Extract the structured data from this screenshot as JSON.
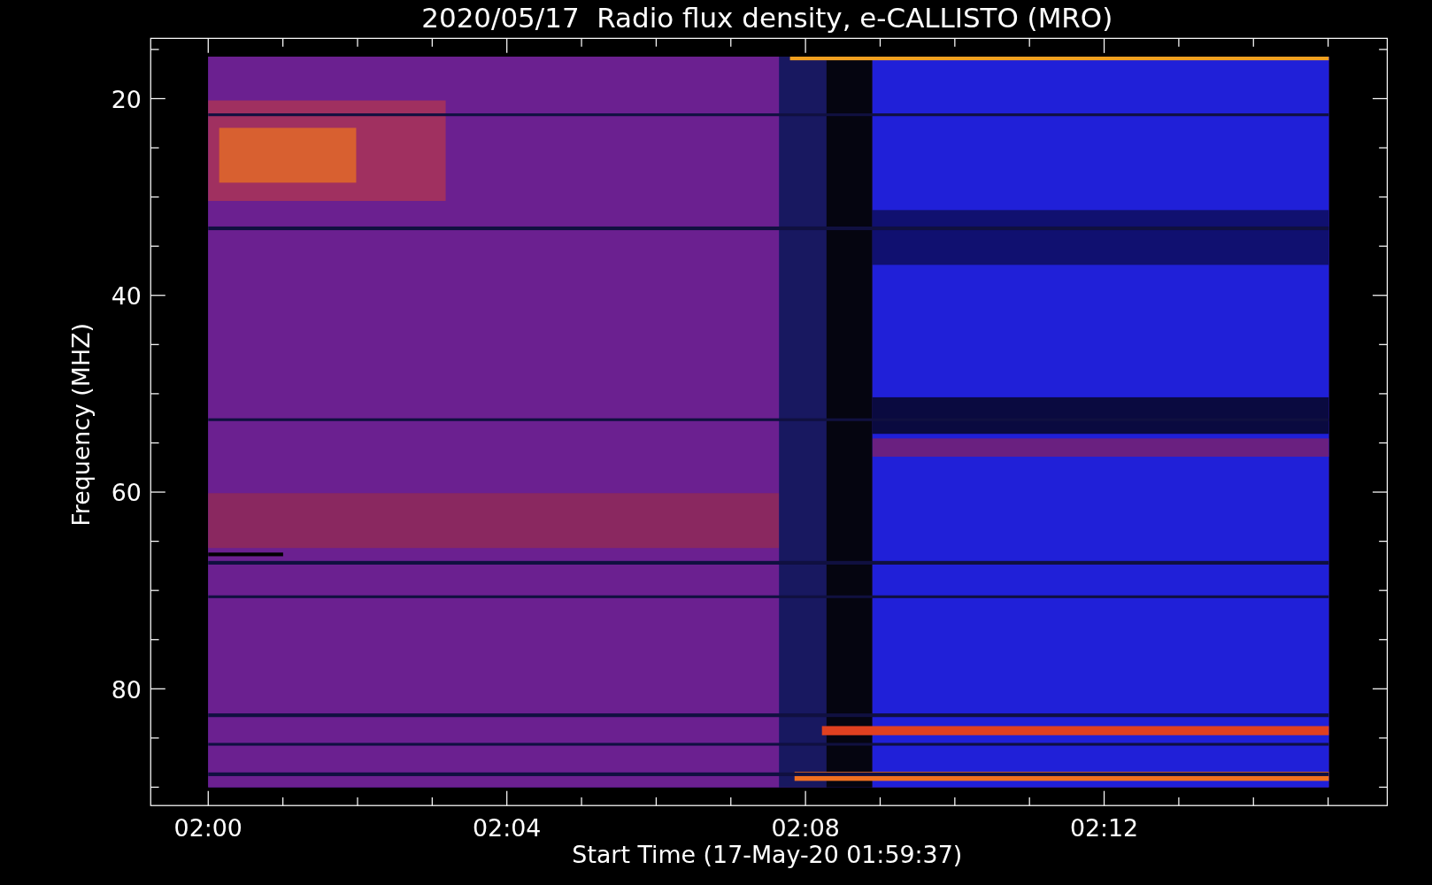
{
  "plot": {
    "title": "2020/05/17  Radio flux density, e-CALLISTO (MRO)",
    "xlabel": "Start Time (17-May-20 01:59:37)",
    "ylabel": "Frequency (MHZ)",
    "yticks": [
      "20",
      "40",
      "60",
      "80"
    ],
    "xticks": [
      "02:00",
      "02:04",
      "02:08",
      "02:12"
    ]
  }
}
